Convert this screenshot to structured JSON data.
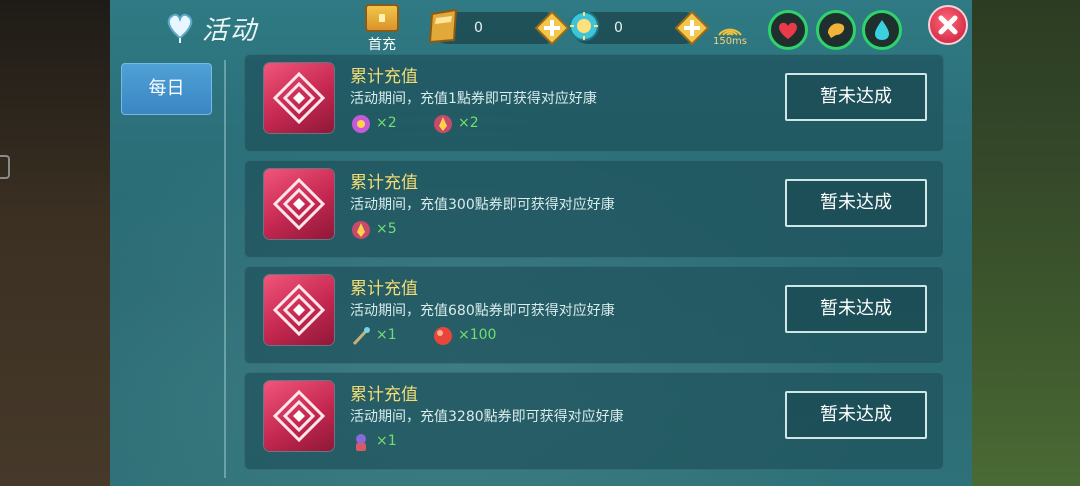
{
  "header": {
    "title": "活动",
    "first_charge_label": "首充",
    "currencies": [
      {
        "icon": "gold-ticket-icon",
        "value": "0"
      },
      {
        "icon": "sun-crystal-icon",
        "value": "0"
      }
    ],
    "ping": "150ms"
  },
  "sidebar": {
    "tabs": [
      {
        "label": "每日"
      }
    ]
  },
  "activities": [
    {
      "title": "累计充值",
      "description": "活动期间，充值1點券即可获得对应好康",
      "rewards": [
        {
          "icon": "purple-gem-icon",
          "count": "×2"
        },
        {
          "icon": "red-flame-icon",
          "count": "×2"
        }
      ],
      "status": "暂未达成"
    },
    {
      "title": "累计充值",
      "description": "活动期间，充值300點券即可获得对应好康",
      "rewards": [
        {
          "icon": "red-flame-icon",
          "count": "×5"
        }
      ],
      "status": "暂未达成"
    },
    {
      "title": "累计充值",
      "description": "活动期间，充值680點券即可获得对应好康",
      "rewards": [
        {
          "icon": "staff-icon",
          "count": "×1"
        },
        {
          "icon": "red-orb-icon",
          "count": "×100"
        }
      ],
      "status": "暂未达成"
    },
    {
      "title": "累计充值",
      "description": "活动期间，充值3280點券即可获得对应好康",
      "rewards": [
        {
          "icon": "pet-figure-icon",
          "count": "×1"
        }
      ],
      "status": "暂未达成"
    }
  ],
  "colors": {
    "panel": "#2b6f79",
    "title_yellow": "#f3dd72",
    "reward_green": "#6fe06f",
    "tab_blue": "#3a86c3",
    "close_red": "#d8304a"
  }
}
